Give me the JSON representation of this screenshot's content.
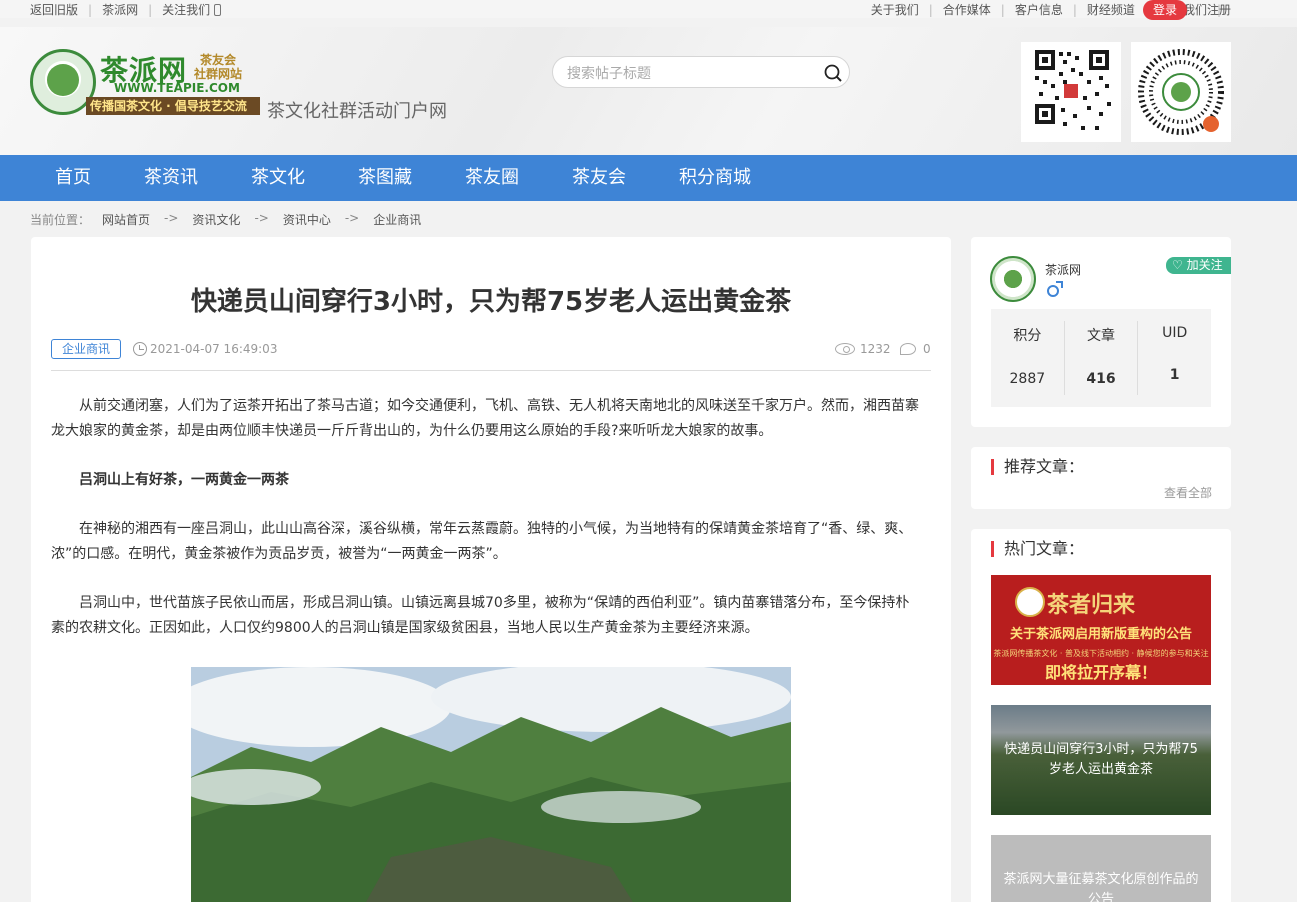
{
  "topbar": {
    "left_links": [
      "返回旧版",
      "茶派网",
      "关注我们"
    ],
    "right_links": [
      "关于我们",
      "合作媒体",
      "客户信息",
      "财经频道",
      "联系我们"
    ],
    "login": "登录",
    "register": "注册"
  },
  "header": {
    "logo_title": "茶派网",
    "logo_sub1": "茶友会",
    "logo_sub2": "社群网站",
    "logo_url": "WWW.TEAPIE.COM",
    "logo_slogan": "传播国茶文化 · 倡导技艺交流",
    "tagline": "茶文化社群活动门户网",
    "search_placeholder": "搜索帖子标题"
  },
  "nav": {
    "items": [
      "首页",
      "茶资讯",
      "茶文化",
      "茶图藏",
      "茶友圈",
      "茶友会",
      "积分商城"
    ]
  },
  "breadcrumb": {
    "label": "当前位置：",
    "items": [
      "网站首页",
      "资讯文化",
      "资讯中心",
      "企业商讯"
    ],
    "arrow": "->"
  },
  "article": {
    "title": "快递员山间穿行3小时，只为帮75岁老人运出黄金茶",
    "category": "企业商讯",
    "date": "2021-04-07 16:49:03",
    "views": "1232",
    "comments": "0",
    "paragraphs": [
      "从前交通闭塞，人们为了运茶开拓出了茶马古道；如今交通便利，飞机、高铁、无人机将天南地北的风味送至千家万户。然而，湘西苗寨龙大娘家的黄金茶，却是由两位顺丰快递员一斤斤背出山的，为什么仍要用这么原始的手段?来听听龙大娘家的故事。",
      "吕洞山上有好茶，一两黄金一两茶",
      "在神秘的湘西有一座吕洞山，此山山高谷深，溪谷纵横，常年云蒸霞蔚。独特的小气候，为当地特有的保靖黄金茶培育了“香、绿、爽、浓”的口感。在明代，黄金茶被作为贡品岁贡，被誉为“一两黄金一两茶”。",
      "吕洞山中，世代苗族子民依山而居，形成吕洞山镇。山镇远离县城70多里，被称为“保靖的西伯利亚”。镇内苗寨错落分布，至今保持朴素的农耕文化。正因如此，人口仅约9800人的吕洞山镇是国家级贫困县，当地人民以生产黄金茶为主要经济来源。"
    ]
  },
  "sidebar": {
    "author": {
      "name": "茶派网",
      "follow": "加关注",
      "stats": [
        {
          "label": "积分",
          "value": "2887"
        },
        {
          "label": "文章",
          "value": "416"
        },
        {
          "label": "UID",
          "value": "1"
        }
      ]
    },
    "recommend": {
      "title": "推荐文章：",
      "view_all": "查看全部"
    },
    "hot": {
      "title": "热门文章：",
      "item1": {
        "heading": "茶者归来",
        "line1": "关于茶派网启用新版重构的公告",
        "line2": "茶派网传播茶文化 · 普及线下活动相约 · 静候您的参与和关注",
        "line3": "即将拉开序幕！"
      },
      "item2": "快递员山间穿行3小时，只为帮75岁老人运出黄金茶",
      "item3": "茶派网大量征募茶文化原创作品的公告"
    }
  }
}
